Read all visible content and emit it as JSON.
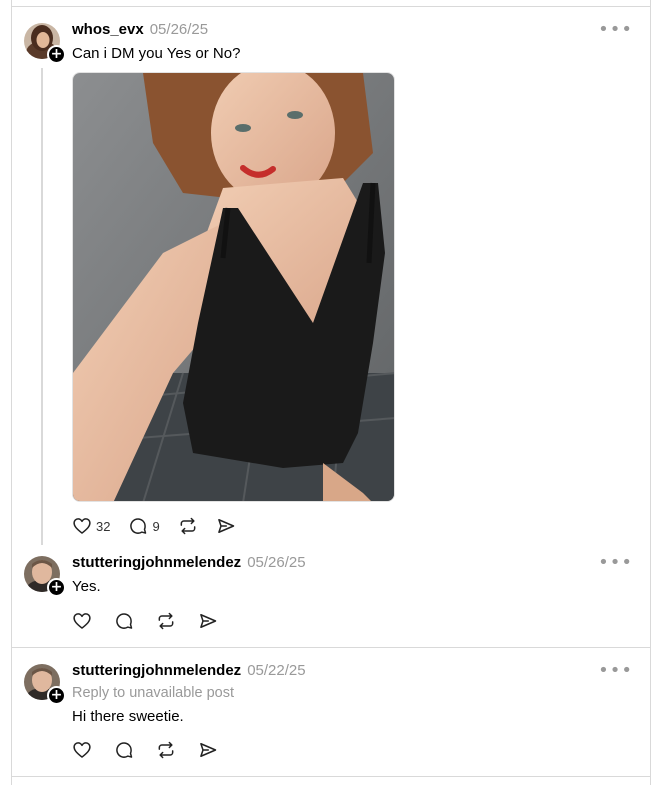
{
  "posts": [
    {
      "username": "whos_evx",
      "date": "05/26/25",
      "text": "Can i DM you Yes or No?",
      "likes": "32",
      "replies": "9",
      "more_icon": "more-horizontal-icon"
    },
    {
      "username": "stutteringjohnmelendez",
      "date": "05/26/25",
      "text": "Yes.",
      "more_icon": "more-horizontal-icon"
    },
    {
      "username": "stutteringjohnmelendez",
      "date": "05/22/25",
      "reply_to": "Reply to unavailable post",
      "text": "Hi there sweetie.",
      "more_icon": "more-horizontal-icon"
    }
  ],
  "icons": {
    "like": "heart-icon",
    "reply": "comment-icon",
    "repost": "repost-icon",
    "share": "send-icon",
    "follow": "plus-icon"
  },
  "colors": {
    "divider": "#d9d9d9",
    "muted": "#999999",
    "text": "#000000"
  }
}
